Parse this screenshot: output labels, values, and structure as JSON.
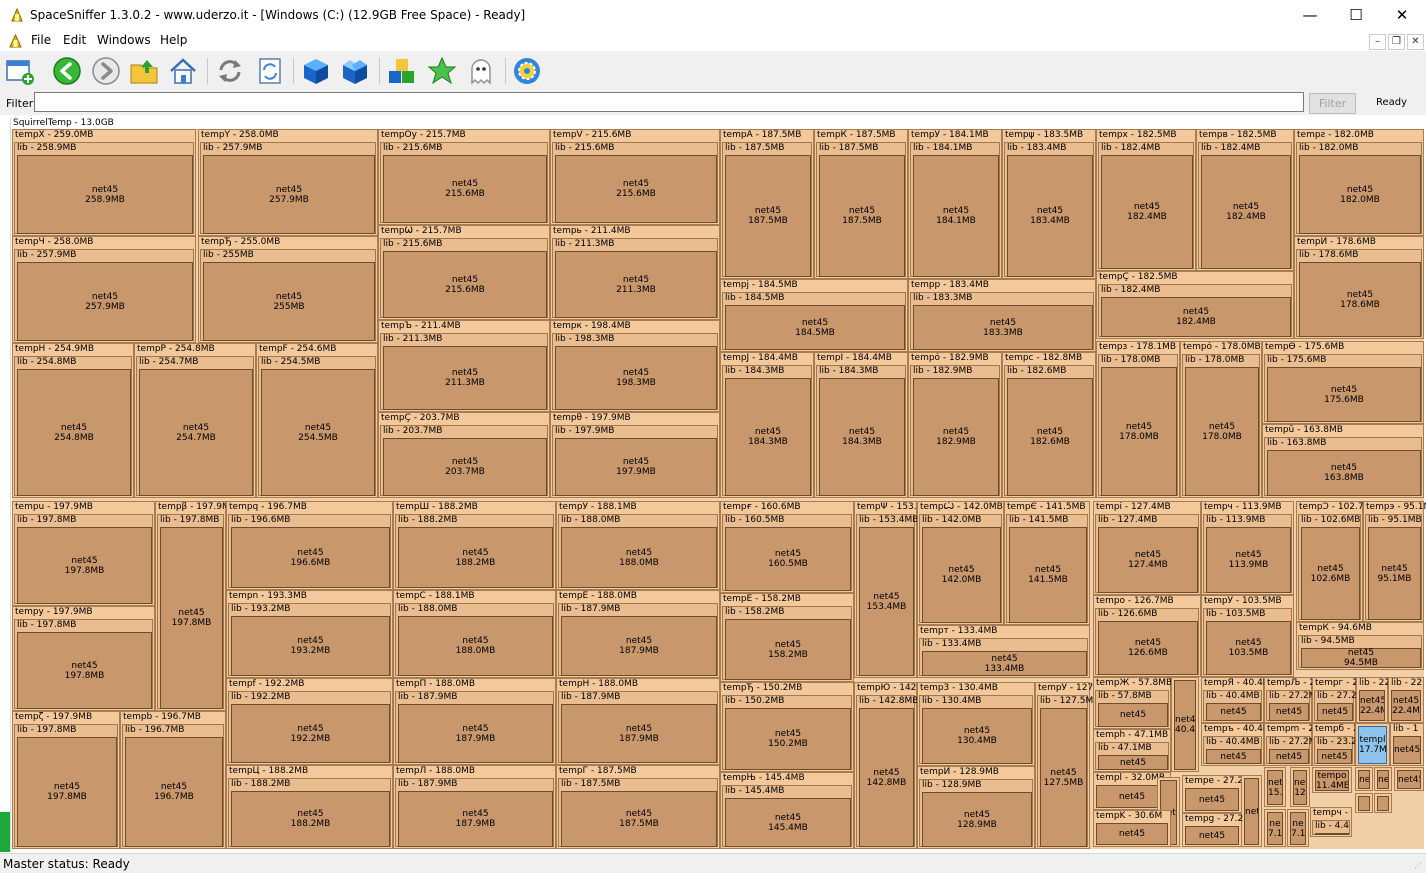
{
  "window": {
    "title": "SpaceSniffer 1.3.0.2 - www.uderzo.it - [Windows (C:) (12.9GB Free Space) - Ready]",
    "minimize_glyph": "—",
    "maximize_glyph": "☐",
    "close_glyph": "✕"
  },
  "menu": {
    "items": [
      "File",
      "Edit",
      "Windows",
      "Help"
    ],
    "mdi_minimize": "–",
    "mdi_restore": "❐",
    "mdi_close": "✕"
  },
  "toolbar": {
    "buttons": [
      {
        "name": "new-window-icon",
        "icon": "window-plus"
      },
      {
        "name": "back-icon",
        "icon": "arrow-left-green"
      },
      {
        "name": "forward-icon",
        "icon": "arrow-right-gray"
      },
      {
        "name": "up-folder-icon",
        "icon": "folder-up"
      },
      {
        "name": "home-icon",
        "icon": "house"
      },
      {
        "name": "refresh-icon",
        "icon": "refresh-arrows"
      },
      {
        "name": "refresh-document-icon",
        "icon": "refresh-doc"
      },
      {
        "name": "blue-cube-icon",
        "icon": "cube"
      },
      {
        "name": "open-cube-icon",
        "icon": "cube-open"
      },
      {
        "name": "color-blocks-icon",
        "icon": "blocks"
      },
      {
        "name": "star-icon",
        "icon": "star"
      },
      {
        "name": "ghost-icon",
        "icon": "ghost"
      },
      {
        "name": "settings-gear-icon",
        "icon": "gear"
      }
    ]
  },
  "filter": {
    "label": "Filter",
    "value": "",
    "button_label": "Filter",
    "status": "Ready"
  },
  "treemap": {
    "root_label": "SquirrelTemp - 13.0GB",
    "colors": {
      "outer": "#f3c89a",
      "lib": "#e9bd90",
      "net": "#c8976c",
      "selected": "#8ec4ec"
    },
    "columns": [
      {
        "kind": "mixed",
        "groups": [
          {
            "rows": [
              [
                {
                  "t": "tempX - 259.0MB",
                  "l": "lib - 258.9MB",
                  "n": "net45\n258.9MB"
                },
                {
                  "t": "tempY - 258.0MB",
                  "l": "lib - 257.9MB",
                  "n": "net45\n257.9MB"
                }
              ],
              [
                {
                  "t": "tempЧ - 258.0MB",
                  "l": "lib - 257.9MB",
                  "n": "net45\n257.9MB"
                },
                {
                  "t": "tempЂ - 255.0MB",
                  "l": "lib - 255MB",
                  "n": "net45\n255MB"
                }
              ],
              [
                {
                  "t": "tempH - 254.9MB",
                  "l": "lib - 254.8MB",
                  "n": "net45\n254.8MB"
                },
                {
                  "t": "tempP - 254.8MB",
                  "l": "lib - 254.7MB",
                  "n": "net45\n254.7MB"
                },
                {
                  "t": "tempF - 254.6MB",
                  "l": "lib - 254.5MB",
                  "n": "net45\n254.5MB"
                }
              ]
            ]
          }
        ]
      }
    ],
    "top_mid": [
      [
        {
          "t": "tempOy - 215.7MB",
          "l": "lib - 215.6MB",
          "n": "net45\n215.6MB"
        },
        {
          "t": "tempV - 215.6MB",
          "l": "lib - 215.6MB",
          "n": "net45\n215.6MB"
        }
      ],
      [
        {
          "t": "tempѾ - 215.7MB",
          "l": "lib - 215.6MB",
          "n": "net45\n215.6MB"
        },
        {
          "t": "tempь - 211.4MB",
          "l": "lib - 211.3MB",
          "n": "net45\n211.3MB"
        }
      ],
      [
        {
          "t": "tempЪ - 211.4MB",
          "l": "lib - 211.3MB",
          "n": "net45\n211.3MB"
        },
        {
          "t": "tempк - 198.4MB",
          "l": "lib - 198.3MB",
          "n": "net45\n198.3MB"
        }
      ],
      [
        {
          "t": "tempÇ - 203.7MB",
          "l": "lib - 203.7MB",
          "n": "net45\n203.7MB"
        },
        {
          "t": "tempθ - 197.9MB",
          "l": "lib - 197.9MB",
          "n": "net45\n197.9MB"
        }
      ]
    ],
    "top_right_a": [
      [
        {
          "t": "tempA - 187.5MB",
          "l": "lib - 187.5MB",
          "n": "net45\n187.5MB"
        },
        {
          "t": "tempК - 187.5MB",
          "l": "lib - 187.5MB",
          "n": "net45\n187.5MB"
        },
        {
          "t": "tempЎ - 184.1MB",
          "l": "lib - 184.1MB",
          "n": "net45\n184.1MB"
        },
        {
          "t": "tempψ - 183.5MB",
          "l": "lib - 183.4MB",
          "n": "net45\n183.4MB"
        }
      ],
      [
        {
          "t": "tempj - 184.5MB",
          "l": "lib - 184.5MB",
          "n": "net45\n184.5MB"
        },
        {
          "t": "tempp - 183.4MB",
          "l": "lib - 183.3MB",
          "n": "net45\n183.3MB"
        }
      ],
      [
        {
          "t": "tempJ - 184.4MB",
          "l": "lib - 184.3MB",
          "n": "net45\n184.3MB"
        },
        {
          "t": "tempI - 184.4MB",
          "l": "lib - 184.3MB",
          "n": "net45\n184.3MB"
        },
        {
          "t": "tempó - 182.9MB",
          "l": "lib - 182.9MB",
          "n": "net45\n182.9MB"
        },
        {
          "t": "tempc - 182.8MB",
          "l": "lib - 182.6MB",
          "n": "net45\n182.6MB"
        }
      ]
    ],
    "top_right_b": [
      {
        "t": "tempx - 182.5MB",
        "l": "lib - 182.4MB",
        "n": "net45\n182.4MB"
      },
      {
        "t": "tempв - 182.5MB",
        "l": "lib - 182.4MB",
        "n": "net45\n182.4MB"
      },
      {
        "t": "tempƨ - 182.0MB",
        "l": "lib - 182.0MB",
        "n": "net45\n182.0MB"
      },
      {
        "t": "tempÇ - 182.5MB",
        "l": "lib - 182.4MB",
        "n": "net45\n182.4MB"
      },
      {
        "t": "tempЙ - 178.6MB",
        "l": "lib - 178.6MB",
        "n": "net45\n178.6MB"
      },
      {
        "t": "tempз - 178.1MB",
        "l": "lib - 178.0MB",
        "n": "net45\n178.0MB"
      },
      {
        "t": "tempó - 178.0MB",
        "l": "lib - 178.0MB",
        "n": "net45\n178.0MB"
      },
      {
        "t": "tempϴ - 175.6MB",
        "l": "lib - 175.6MB",
        "n": "net45\n175.6MB"
      },
      {
        "t": "tempŭ - 163.8MB",
        "l": "lib - 163.8MB",
        "n": "net45\n163.8MB"
      }
    ],
    "bottom_left": [
      {
        "t": "tempu - 197.9MB",
        "l": "lib - 197.8MB",
        "n": "net45\n197.8MB"
      },
      {
        "t": "tempβ - 197.9MB",
        "l": "lib - 197.8MB",
        "n": "net45\n197.8MB"
      },
      {
        "t": "tempy - 197.9MB",
        "l": "lib - 197.8MB",
        "n": "net45\n197.8MB"
      },
      {
        "t": "tempζ - 197.9MB",
        "l": "lib - 197.8MB",
        "n": "net45\n197.8MB"
      },
      {
        "t": "tempb - 196.7MB",
        "l": "lib - 196.7MB",
        "n": "net45\n196.7MB"
      }
    ],
    "bottom_mid": [
      [
        {
          "t": "tempq - 196.7MB",
          "l": "lib - 196.6MB",
          "n": "net45\n196.6MB"
        },
        {
          "t": "tempШ - 188.2MB",
          "l": "lib - 188.2MB",
          "n": "net45\n188.2MB"
        },
        {
          "t": "tempУ - 188.1MB",
          "l": "lib - 188.0MB",
          "n": "net45\n188.0MB"
        }
      ],
      [
        {
          "t": "tempn - 193.3MB",
          "l": "lib - 193.2MB",
          "n": "net45\n193.2MB"
        },
        {
          "t": "tempC - 188.1MB",
          "l": "lib - 188.0MB",
          "n": "net45\n188.0MB"
        },
        {
          "t": "tempE - 188.0MB",
          "l": "lib - 187.9MB",
          "n": "net45\n187.9MB"
        }
      ],
      [
        {
          "t": "tempf - 192.2MB",
          "l": "lib - 192.2MB",
          "n": "net45\n192.2MB"
        },
        {
          "t": "tempП - 188.0MB",
          "l": "lib - 187.9MB",
          "n": "net45\n187.9MB"
        },
        {
          "t": "tempH - 188.0MB",
          "l": "lib - 187.9MB",
          "n": "net45\n187.9MB"
        }
      ],
      [
        {
          "t": "tempЦ - 188.2MB",
          "l": "lib - 188.2MB",
          "n": "net45\n188.2MB"
        },
        {
          "t": "tempЛ - 188.0MB",
          "l": "lib - 187.9MB",
          "n": "net45\n187.9MB"
        },
        {
          "t": "tempГ - 187.5MB",
          "l": "lib - 187.5MB",
          "n": "net45\n187.5MB"
        }
      ]
    ],
    "bottom_right": [
      {
        "t": "tempғ - 160.6MB",
        "l": "lib - 160.5MB",
        "n": "net45\n160.5MB"
      },
      {
        "t": "tempΨ - 153.4",
        "l": "lib - 153.4MB",
        "n": "net45\n153.4MB"
      },
      {
        "t": "tempѼ - 142.0MB",
        "l": "lib - 142.0MB",
        "n": "net45\n142.0MB"
      },
      {
        "t": "tempЄ - 141.5MB",
        "l": "lib - 141.5MB",
        "n": "net45\n141.5MB"
      },
      {
        "t": "tempĖ - 158.2MB",
        "l": "lib - 158.2MB",
        "n": "net45\n158.2MB"
      },
      {
        "t": "tempт - 133.4MB",
        "l": "lib - 133.4MB",
        "n": "net45\n133.4MB"
      },
      {
        "t": "tempЂ - 150.2MB",
        "l": "lib - 150.2MB",
        "n": "net45\n150.2MB"
      },
      {
        "t": "tempЮ - 142.8",
        "l": "lib - 142.8MB",
        "n": "net45\n142.8MB"
      },
      {
        "t": "temp3 - 130.4MB",
        "l": "lib - 130.4MB",
        "n": "net45\n130.4MB"
      },
      {
        "t": "tempЎ - 127.",
        "l": "lib - 127.5M",
        "n": "net45\n127.5MB"
      },
      {
        "t": "tempЊ - 145.4MB",
        "l": "lib - 145.4MB",
        "n": "net45\n145.4MB"
      },
      {
        "t": "tempЙ - 128.9MB",
        "l": "lib - 128.9MB",
        "n": "net45\n128.9MB"
      },
      {
        "t": "tempі - 127.4MB",
        "l": "lib - 127.4MB",
        "n": "net45\n127.4MB"
      },
      {
        "t": "tempч - 113.9MB",
        "l": "lib - 113.9MB",
        "n": "net45\n113.9MB"
      },
      {
        "t": "tempϽ - 102.7",
        "l": "lib - 102.6MB",
        "n": "net45\n102.6MB"
      },
      {
        "t": "tempэ - 95.1MB",
        "l": "lib - 95.1MB",
        "n": "net45\n95.1MB"
      },
      {
        "t": "tempo - 126.7MB",
        "l": "lib - 126.6MB",
        "n": "net45\n126.6MB"
      },
      {
        "t": "tempЎ - 103.5MB",
        "l": "lib - 103.5MB",
        "n": "net45\n103.5MB"
      },
      {
        "t": "tempК - 94.6MB",
        "l": "lib - 94.5MB",
        "n": "net45\n94.5MB"
      },
      {
        "t": "tempЖ - 57.8MB",
        "l": "lib - 57.8MB",
        "n": "net45"
      },
      {
        "t": "",
        "l": "",
        "n": "net4\n40.4"
      },
      {
        "t": "tempЯ - 40.4M",
        "l": "lib - 40.4MB",
        "n": "net45"
      },
      {
        "t": "tempЉ - 27",
        "l": "lib - 27.2M",
        "n": "net45"
      },
      {
        "t": "tempг - 2",
        "l": "lib - 27.2",
        "n": "net45"
      },
      {
        "t": "lib - 22",
        "l": "",
        "n": "net45\n22.4M"
      },
      {
        "t": "lib - 22",
        "l": "",
        "n": "net45\n22.4M"
      },
      {
        "t": "temph - 47.1MB",
        "l": "lib - 47.1MB",
        "n": "net45"
      },
      {
        "t": "tempъ - 40.4M",
        "l": "lib - 40.4MB",
        "n": "net45"
      },
      {
        "t": "tempm - 2",
        "l": "lib - 27.2M",
        "n": "net45"
      },
      {
        "t": "tempб - 2",
        "l": "lib - 23.2",
        "n": "net45"
      },
      {
        "t": "",
        "l": "",
        "n": "templ\n17.7MB"
      },
      {
        "t": "lib - 1",
        "l": "",
        "n": "net45"
      },
      {
        "t": "templ - 32.0MB",
        "l": "",
        "n": "net45"
      },
      {
        "t": "tempe - 27.2",
        "l": "",
        "n": "net45"
      },
      {
        "t": "",
        "l": "",
        "n": "net4"
      },
      {
        "t": "",
        "l": "",
        "n": "net4"
      },
      {
        "t": "",
        "l": "",
        "n": "net45\n15.7"
      },
      {
        "t": "",
        "l": "",
        "n": "net45\n12"
      },
      {
        "t": "",
        "l": "",
        "n": "tempo\n11.4ME"
      },
      {
        "t": "",
        "l": "",
        "n": "ne"
      },
      {
        "t": "",
        "l": "",
        "n": "ne"
      },
      {
        "t": "",
        "l": "",
        "n": "net45"
      },
      {
        "t": "tempK - 30.6M",
        "l": "",
        "n": "net45"
      },
      {
        "t": "tempg - 27.2",
        "l": "",
        "n": "net45"
      },
      {
        "t": "",
        "l": "",
        "n": "ne\n7.1"
      },
      {
        "t": "",
        "l": "",
        "n": "ne\n7.1"
      },
      {
        "t": "tempч -",
        "l": "lib - 4.4",
        "n": ""
      },
      {
        "t": "",
        "l": "",
        "n": ""
      },
      {
        "t": "",
        "l": "",
        "n": ""
      },
      {
        "t": "",
        "l": "",
        "n": ""
      }
    ]
  },
  "status": {
    "text": "Master status: Ready"
  }
}
